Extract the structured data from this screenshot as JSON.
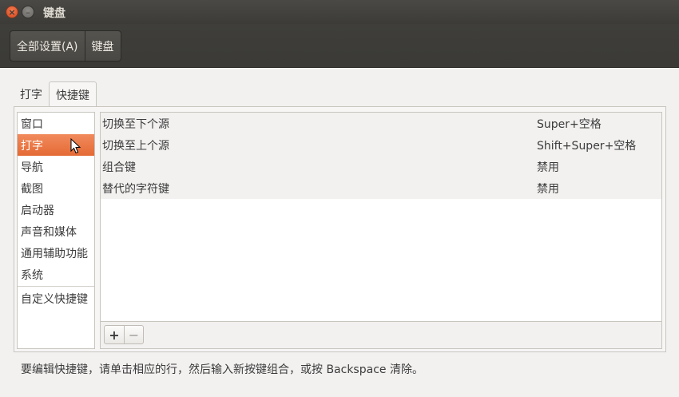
{
  "window": {
    "title": "键盘",
    "close_glyph": "×",
    "minimize_glyph": "–"
  },
  "toolbar": {
    "breadcrumbs": [
      "全部设置(A)",
      "键盘"
    ]
  },
  "tabs": [
    {
      "label": "打字",
      "active": false
    },
    {
      "label": "快捷键",
      "active": true
    }
  ],
  "categories": {
    "items": [
      "窗口",
      "打字",
      "导航",
      "截图",
      "启动器",
      "声音和媒体",
      "通用辅助功能",
      "系统"
    ],
    "custom": "自定义快捷键",
    "selected": "打字"
  },
  "shortcuts": [
    {
      "name": "切换至下个源",
      "key": "Super+空格"
    },
    {
      "name": "切换至上个源",
      "key": "Shift+Super+空格"
    },
    {
      "name": "组合键",
      "key": "禁用"
    },
    {
      "name": "替代的字符键",
      "key": "禁用"
    }
  ],
  "controls": {
    "add": "+",
    "remove": "−"
  },
  "hint": "要编辑快捷键，请单击相应的行，然后输入新按键组合，或按 Backspace 清除。",
  "colors": {
    "accent": "#e46a35",
    "titlebar": "#3c3b37"
  }
}
